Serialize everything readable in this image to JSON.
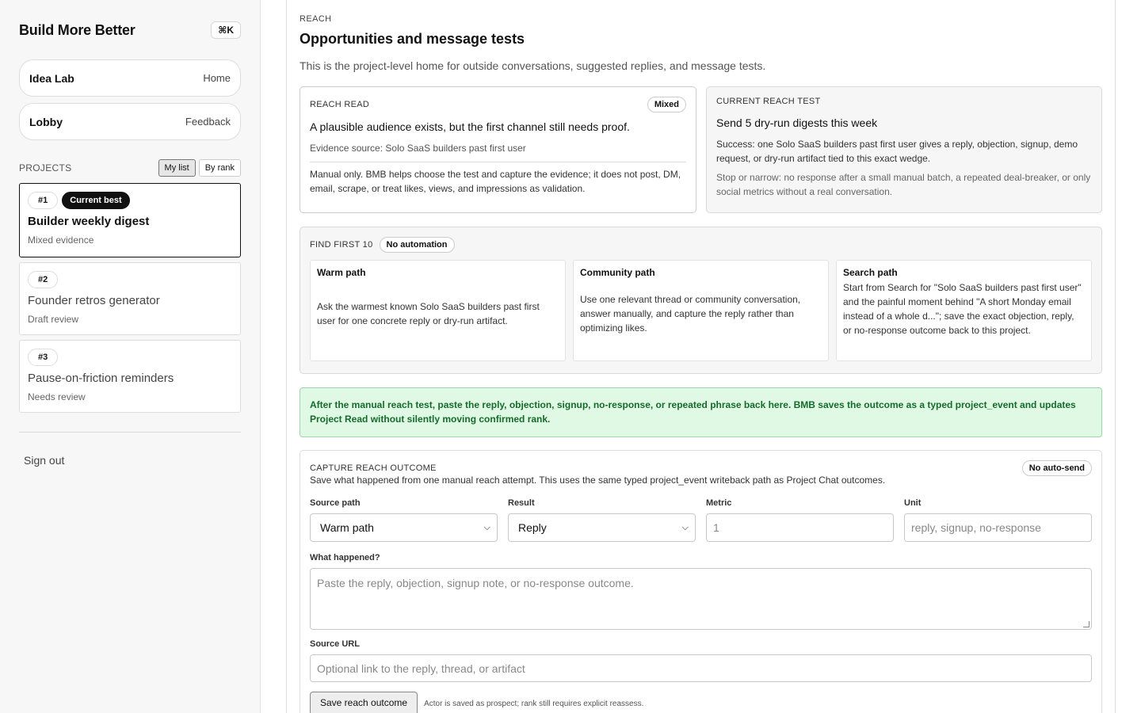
{
  "sidebar": {
    "brand": "Build More Better",
    "shortcut": "⌘K",
    "nav": [
      {
        "title": "Idea Lab",
        "right": "Home"
      },
      {
        "title": "Lobby",
        "right": "Feedback"
      }
    ],
    "projects_label": "PROJECTS",
    "sort": {
      "my_list": "My list",
      "by_rank": "By rank"
    },
    "projects": [
      {
        "rank": "#1",
        "badge": "Current best",
        "title": "Builder weekly digest",
        "sub": "Mixed evidence"
      },
      {
        "rank": "#2",
        "title": "Founder retros generator",
        "sub": "Draft review"
      },
      {
        "rank": "#3",
        "title": "Pause-on-friction reminders",
        "sub": "Needs review"
      }
    ],
    "sign_out": "Sign out"
  },
  "main": {
    "eyebrow": "REACH",
    "title": "Opportunities and message tests",
    "desc": "This is the project-level home for outside conversations, suggested replies, and message tests.",
    "read": {
      "label": "REACH READ",
      "badge": "Mixed",
      "headline": "A plausible audience exists, but the first channel still needs proof.",
      "source": "Evidence source: Solo SaaS builders past first user",
      "note": "Manual only. BMB helps choose the test and capture the evidence; it does not post, DM, email, scrape, or treat likes, views, and impressions as validation."
    },
    "test": {
      "label": "CURRENT REACH TEST",
      "title": "Send 5 dry-run digests this week",
      "success": "Success: one Solo SaaS builders past first user gives a reply, objection, signup, demo request, or dry-run artifact tied to this exact wedge.",
      "stop": "Stop or narrow: no response after a small manual batch, a repeated deal-breaker, or only social metrics without a real conversation."
    },
    "find": {
      "label": "FIND FIRST 10",
      "badge": "No automation",
      "paths": [
        {
          "title": "Warm path",
          "body": "Ask the warmest known Solo SaaS builders past first user for one concrete reply or dry-run artifact."
        },
        {
          "title": "Community path",
          "body": "Use one relevant thread or community conversation, answer manually, and capture the reply rather than optimizing likes."
        },
        {
          "title": "Search path",
          "body": "Start from Search for \"Solo SaaS builders past first user\" and the painful moment behind \"A short Monday email instead of a whole d...\"; save the exact objection, reply, or no-response outcome back to this project."
        }
      ]
    },
    "notice": "After the manual reach test, paste the reply, objection, signup, no-response, or repeated phrase back here. BMB saves the outcome as a typed project_event and updates Project Read without silently moving confirmed rank.",
    "capture": {
      "label": "CAPTURE REACH OUTCOME",
      "badge": "No auto-send",
      "desc": "Save what happened from one manual reach attempt. This uses the same typed project_event writeback path as Project Chat outcomes.",
      "source_label": "Source path",
      "source_value": "Warm path",
      "result_label": "Result",
      "result_value": "Reply",
      "metric_label": "Metric",
      "metric_placeholder": "1",
      "unit_label": "Unit",
      "unit_placeholder": "reply, signup, no-response",
      "what_label": "What happened?",
      "what_placeholder": "Paste the reply, objection, signup note, or no-response outcome.",
      "url_label": "Source URL",
      "url_placeholder": "Optional link to the reply, thread, or artifact",
      "save_label": "Save reach outcome",
      "save_note": "Actor is saved as prospect; rank still requires explicit reassess."
    }
  }
}
